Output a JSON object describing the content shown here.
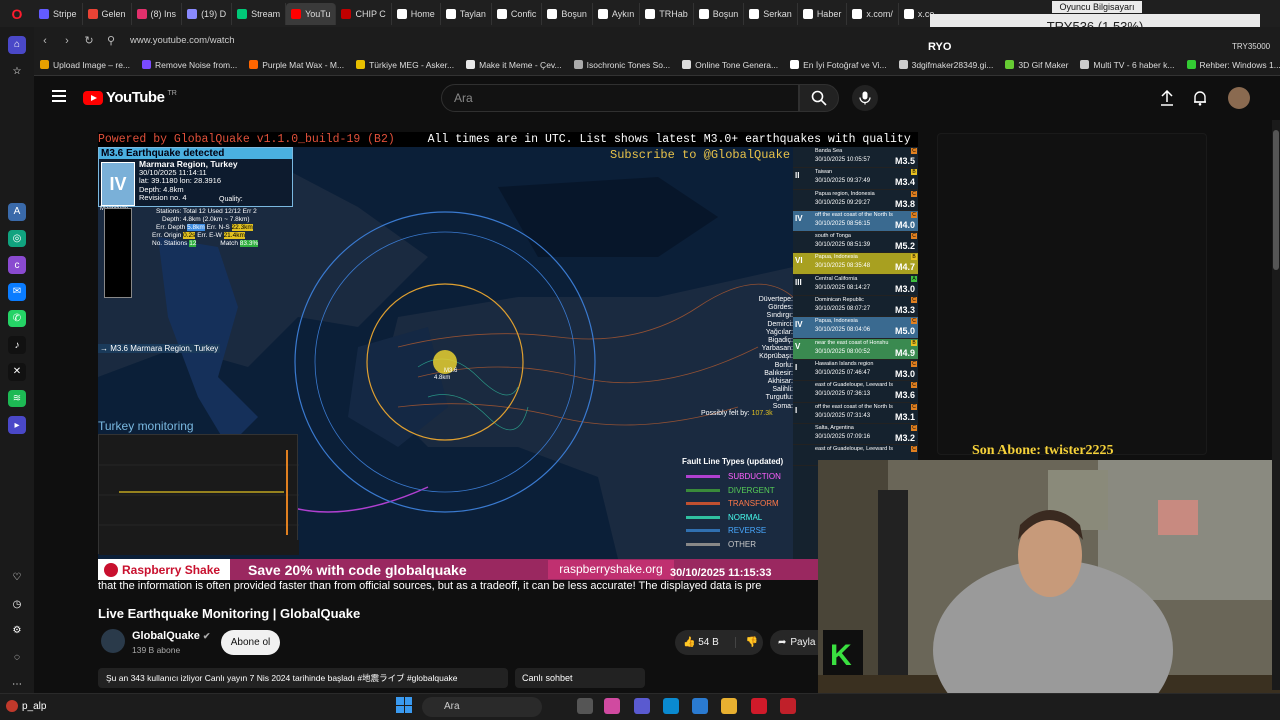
{
  "browser": {
    "tabs": [
      {
        "label": "Stripe",
        "color": "#635bff"
      },
      {
        "label": "Gelen",
        "color": "#ea4335"
      },
      {
        "label": "(8) Ins",
        "color": "#e1306c"
      },
      {
        "label": "(19) D",
        "color": "#8a8aff"
      },
      {
        "label": "Stream",
        "color": "#00c878"
      },
      {
        "label": "YouTu",
        "color": "#ff0000"
      },
      {
        "label": "CHIP C",
        "color": "#c00000"
      },
      {
        "label": "Home",
        "color": "#ffffff"
      },
      {
        "label": "Taylan",
        "color": "#ffffff"
      },
      {
        "label": "Confic",
        "color": "#ffffff"
      },
      {
        "label": "Boşun",
        "color": "#ffffff"
      },
      {
        "label": "Aykın",
        "color": "#ffffff"
      },
      {
        "label": "TRHab",
        "color": "#ffffff"
      },
      {
        "label": "Boşun",
        "color": "#ffffff"
      },
      {
        "label": "Serkan",
        "color": "#ffffff"
      },
      {
        "label": "Haber",
        "color": "#ffffff"
      },
      {
        "label": "x.com/",
        "color": "#ffffff"
      },
      {
        "label": "x.com/",
        "color": "#ffffff"
      },
      {
        "label": "x.com/",
        "color": "#ffffff"
      },
      {
        "label": "x.com/",
        "color": "#ffffff"
      },
      {
        "label": "Home",
        "color": "#ffffff"
      }
    ],
    "url": "www.youtube.com/watch",
    "bookmarks": [
      {
        "label": "Upload Image – re...",
        "color": "#e8a000"
      },
      {
        "label": "Remove Noise from...",
        "color": "#7a4aff"
      },
      {
        "label": "Purple Mat Wax - M...",
        "color": "#f60"
      },
      {
        "label": "Türkiye MEG - Asker...",
        "color": "#e8c000"
      },
      {
        "label": "Make it Meme - Çev...",
        "color": "#e8e8e8"
      },
      {
        "label": "Isochronic Tones So...",
        "color": "#aaa"
      },
      {
        "label": "Online Tone Genera...",
        "color": "#ddd"
      },
      {
        "label": "En İyi Fotoğraf ve Vi...",
        "color": "#fff"
      },
      {
        "label": "3dgifmaker28349.gi...",
        "color": "#ccc"
      },
      {
        "label": "3D Gif Maker",
        "color": "#6c3"
      },
      {
        "label": "Multi TV - 6 haber k...",
        "color": "#ccc"
      },
      {
        "label": "Rehber: Windows 1...",
        "color": "#3c3"
      }
    ]
  },
  "overlay": {
    "viewer_label": "Oyuncu Bilgisayarı",
    "ticker": "TRY536 (1.53%)",
    "ryo": "RYO",
    "try_total": "TRY35000",
    "last_subscriber": "Son Abone: twister2225"
  },
  "youtube": {
    "logo": "YouTube",
    "region": "TR",
    "search_placeholder": "Ara"
  },
  "video": {
    "header_left": "Powered by GlobalQuake v1.1.0_build-19 (B2)",
    "header_right": "All times are in UTC.  List shows latest M3.0+ earthquakes with quality of C or better",
    "subscribe_text": "Subscribe to @GlobalQuake!",
    "detected_title": "M3.6 Earthquake detected",
    "intensity": "IV",
    "region": "Marmara Region, Turkey",
    "datetime": "30/10/2025 11:14:11",
    "latlon": "lat: 39.1180 lon: 28.3916",
    "depth": "Depth: 4.8km",
    "revision": "Revision no. 4",
    "quality_label": "Quality:",
    "magnitude_label": "Magnitude",
    "stations": "Stations: Total 12 Used 12/12 Err 2",
    "depth_range": "Depth: 4.8km (2.0km ~ 7.8km)",
    "err_depth": "Err. Depth",
    "err_depth_v": "5.8km",
    "err_ns": "Err. N-S",
    "err_ns_v": "22.3km",
    "err_origin": "Err. Origin",
    "err_origin_v": "0.2s",
    "err_ew": "Err. E-W",
    "err_ew_v": "21.4km",
    "no_stations": "No. Stations",
    "no_stations_v": "12",
    "match": "Match",
    "match_v": "83.3%",
    "map_label": "→ M3.6 Marmara Region, Turkey",
    "epicenter_mag": "M3.6",
    "epicenter_depth": "4.8km",
    "places": [
      "Düvertepe:",
      "Gördes:",
      "Sındırgı:",
      "Demirci:",
      "Yağcılar:",
      "Bigadiç:",
      "Yarbasan:",
      "Köprübaşı:",
      "Borlu:",
      "Balıkesir:",
      "Akhisar:",
      "Salihli:",
      "Turgutlu:",
      "Soma:"
    ],
    "possibly_felt": "Possibly felt by:",
    "possibly_felt_v": "107.3k",
    "monitoring_label": "Turkey monitoring",
    "fault_title": "Fault Line Types (updated)",
    "faults": [
      {
        "label": "SUBDUCTION",
        "color": "#b040d0"
      },
      {
        "label": "DIVERGENT",
        "color": "#3a8a3a"
      },
      {
        "label": "TRANSFORM",
        "color": "#c05030"
      },
      {
        "label": "NORMAL",
        "color": "#30c0a0"
      },
      {
        "label": "REVERSE",
        "color": "#3070b0"
      },
      {
        "label": "OTHER",
        "color": "#888888"
      }
    ],
    "quakes": [
      {
        "int": "",
        "region": "Banda Sea",
        "dt": "30/10/2025 10:05:57",
        "mag": "M3.5",
        "bg": "#15222e",
        "q": "C",
        "qc": "#e08020"
      },
      {
        "int": "II",
        "region": "Taiwan",
        "dt": "30/10/2025 09:37:49",
        "mag": "M3.4",
        "bg": "#15222e",
        "q": "B",
        "qc": "#e8c020"
      },
      {
        "int": "",
        "region": "Papua region, Indonesia",
        "dt": "30/10/2025 09:29:27",
        "mag": "M3.8",
        "bg": "#15222e",
        "q": "C",
        "qc": "#e08020"
      },
      {
        "int": "IV",
        "region": "off the east coast of the North Is",
        "dt": "30/10/2025 08:56:15",
        "mag": "M4.0",
        "bg": "#3a6a90",
        "q": "C",
        "qc": "#e08020"
      },
      {
        "int": "",
        "region": "south of Tonga",
        "dt": "30/10/2025 08:51:39",
        "mag": "M5.2",
        "bg": "#15222e",
        "q": "C",
        "qc": "#e08020"
      },
      {
        "int": "VI",
        "region": "Papua, Indonesia",
        "dt": "30/10/2025 08:35:48",
        "mag": "M4.7",
        "bg": "#a8a020",
        "q": "B",
        "qc": "#e8c020"
      },
      {
        "int": "III",
        "region": "Central California",
        "dt": "30/10/2025 08:14:27",
        "mag": "M3.0",
        "bg": "#15222e",
        "q": "A",
        "qc": "#40c040"
      },
      {
        "int": "",
        "region": "Dominican Republic",
        "dt": "30/10/2025 08:07:27",
        "mag": "M3.3",
        "bg": "#15222e",
        "q": "C",
        "qc": "#e08020"
      },
      {
        "int": "IV",
        "region": "Papua, Indonesia",
        "dt": "30/10/2025 08:04:06",
        "mag": "M5.0",
        "bg": "#3a6a90",
        "q": "C",
        "qc": "#e08020"
      },
      {
        "int": "V",
        "region": "near the east coast of Honshu",
        "dt": "30/10/2025 08:00:52",
        "mag": "M4.9",
        "bg": "#3a8a50",
        "q": "B",
        "qc": "#e8c020"
      },
      {
        "int": "I",
        "region": "Hawaiian Islands region",
        "dt": "30/10/2025 07:46:47",
        "mag": "M3.0",
        "bg": "#15222e",
        "q": "C",
        "qc": "#e08020"
      },
      {
        "int": "",
        "region": "east of Guadeloupe, Leeward Is",
        "dt": "30/10/2025 07:36:13",
        "mag": "M3.6",
        "bg": "#15222e",
        "q": "C",
        "qc": "#e08020"
      },
      {
        "int": "I",
        "region": "off the east coast of the North Is",
        "dt": "30/10/2025 07:31:43",
        "mag": "M3.1",
        "bg": "#15222e",
        "q": "C",
        "qc": "#e08020"
      },
      {
        "int": "",
        "region": "Salta, Argentina",
        "dt": "30/10/2025 07:09:16",
        "mag": "M3.2",
        "bg": "#15222e",
        "q": "C",
        "qc": "#e08020"
      },
      {
        "int": "",
        "region": "east of Guadeloupe, Leeward Is",
        "dt": "",
        "mag": "",
        "bg": "#15222e",
        "q": "C",
        "qc": "#e08020"
      }
    ],
    "ad_brand": "Raspberry Shake",
    "ad_text": "Save 20% with code globalquake",
    "ad_url": "raspberryshake.org",
    "timestamp": "30/10/2025 11:15:33",
    "caption": "that the information is often provided faster than from official sources, but as a tradeoff, it can be less accurate! The displayed data is pre"
  },
  "watch": {
    "title": "Live Earthquake Monitoring | GlobalQuake",
    "channel": "GlobalQuake",
    "subscribers": "139 B abone",
    "subscribe_label": "Abone ol",
    "likes": "54 B",
    "share_label": "Payla",
    "description": "Şu an 343 kullanıcı izliyor  Canlı yayın 7 Nis 2024 tarihinde başladı  #地震ライブ #globalquake",
    "chat_label": "Canlı sohbet"
  },
  "taskbar": {
    "user": "p_alp",
    "search": "Ara"
  }
}
